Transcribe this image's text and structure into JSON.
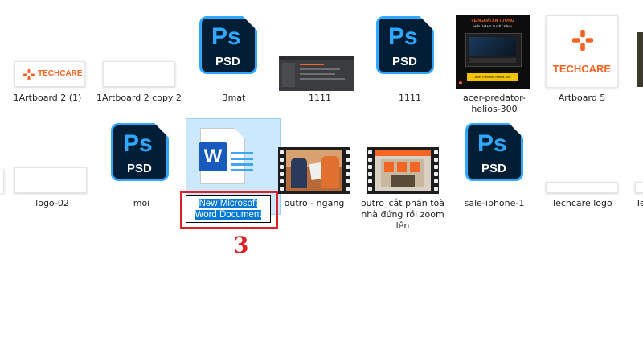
{
  "files_row1": [
    {
      "name": "1Artboard 2 (1)",
      "brand_text": "TECHCARE"
    },
    {
      "name": "1Artboard 2 copy 2"
    },
    {
      "name": "3mat",
      "type": "psd",
      "icon_text": "Ps",
      "ext_text": "PSD"
    },
    {
      "name": "1111"
    },
    {
      "name": "1111",
      "type": "psd",
      "icon_text": "Ps",
      "ext_text": "PSD"
    },
    {
      "name": "acer-predator-helios-300",
      "thumb_title": "VẺ NGOÀI ẤN TƯỢNG",
      "thumb_subtitle": "HIỆU NĂNG TUYỆT ĐỈNH",
      "thumb_caption": "Acer Predator Helios 300"
    },
    {
      "name": "Artboard 5",
      "brand_text": "TECHCARE"
    }
  ],
  "files_row2": [
    {
      "name": "logo-02"
    },
    {
      "name": "moi",
      "type": "psd",
      "icon_text": "Ps",
      "ext_text": "PSD"
    },
    {
      "name": "New Microsoft Word Document",
      "type": "docx",
      "selected": true,
      "icon_text": "W",
      "rename_line1": "New Microsoft",
      "rename_line2": "Word Document"
    },
    {
      "name": "outro - ngang",
      "type": "video"
    },
    {
      "name": "outro_cắt phần toà nhà đứng rồi zoom lên",
      "type": "video"
    },
    {
      "name": "sale-iphone-1",
      "type": "psd",
      "icon_text": "Ps",
      "ext_text": "PSD"
    },
    {
      "name": "Techcare logo"
    },
    {
      "name": "Te"
    }
  ],
  "annotation": {
    "step": "3",
    "color": "#d8232a"
  },
  "colors": {
    "ps_bg": "#001e36",
    "ps_accent": "#31a8ff",
    "word_blue": "#185abd",
    "selection": "#cce8ff",
    "brand_orange": "#f26522"
  }
}
